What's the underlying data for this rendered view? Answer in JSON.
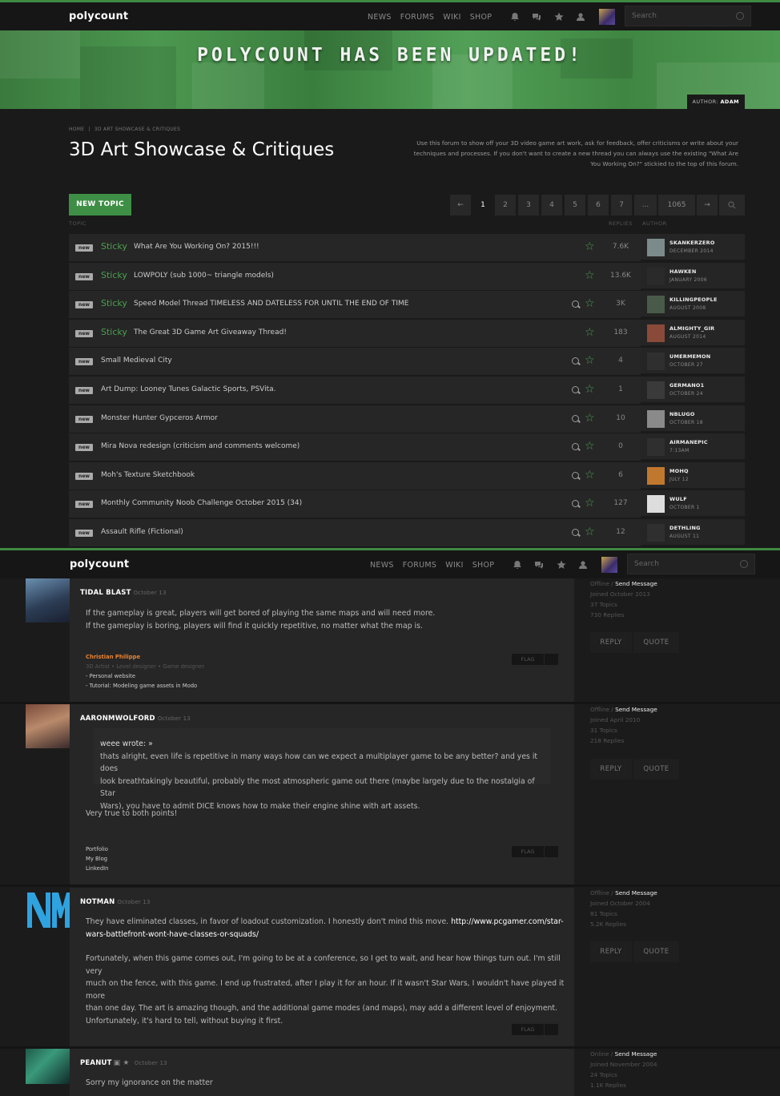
{
  "nav": {
    "logo": "polycount",
    "links": [
      "NEWS",
      "FORUMS",
      "WIKI",
      "SHOP"
    ],
    "search_placeholder": "Search"
  },
  "banner": {
    "title": "POLYCOUNT HAS BEEN UPDATED!",
    "author_label": "AUTHOR:",
    "author_name": "ADAM"
  },
  "breadcrumb": [
    "HOME",
    "3D ART SHOWCASE & CRITIQUES"
  ],
  "page_title": "3D Art Showcase & Critiques",
  "description": "Use this forum to show off your 3D video game art work, ask for feedback, offer criticisms or write about your techniques and processes. If you don't want to create a new thread you can always use the existing \"What Are You Working On?\" stickied to the top of this forum.",
  "new_topic": "NEW TOPIC",
  "pagination": {
    "prev": "←",
    "pages": [
      "1",
      "2",
      "3",
      "4",
      "5",
      "6",
      "7",
      "...",
      "1065"
    ],
    "next": "→"
  },
  "columns": {
    "topic": "TOPIC",
    "replies": "REPLIES",
    "author": "AUTHOR"
  },
  "threads": [
    {
      "badge": "new",
      "sticky": "Sticky",
      "title": "What Are You Working On? 2015!!!",
      "search": false,
      "replies": "7.6K",
      "author": "SKANKERZERO",
      "date": "DECEMBER 2014",
      "avatar_color": "#7b8a8a"
    },
    {
      "badge": "new",
      "sticky": "Sticky",
      "title": "LOWPOLY (sub 1000~ triangle models)",
      "search": false,
      "replies": "13.6K",
      "author": "HAWKEN",
      "date": "JANUARY 2006",
      "avatar_color": "#2a2a2a"
    },
    {
      "badge": "new",
      "sticky": "Sticky",
      "title": "Speed Model Thread TIMELESS AND DATELESS FOR UNTIL THE END OF TIME",
      "search": true,
      "replies": "3K",
      "author": "KILLINGPEOPLE",
      "date": "AUGUST 2008",
      "avatar_color": "#4a5a4a"
    },
    {
      "badge": "new",
      "sticky": "Sticky",
      "title": "The Great 3D Game Art Giveaway Thread!",
      "search": false,
      "replies": "183",
      "author": "ALMIGHTY_GIR",
      "date": "AUGUST 2014",
      "avatar_color": "#8a4a3a"
    },
    {
      "badge": "new",
      "sticky": "",
      "title": "Small Medieval City",
      "search": true,
      "replies": "4",
      "author": "UMERMEMON",
      "date": "OCTOBER 27",
      "avatar_color": "#2f2f2f"
    },
    {
      "badge": "new",
      "sticky": "",
      "title": "Art Dump: Looney Tunes Galactic Sports, PSVita.",
      "search": true,
      "replies": "1",
      "author": "GERMANO1",
      "date": "OCTOBER 24",
      "avatar_color": "#3a3a3a"
    },
    {
      "badge": "new",
      "sticky": "",
      "title": "Monster Hunter Gypceros Armor",
      "search": true,
      "replies": "10",
      "author": "NBLUGO",
      "date": "OCTOBER 18",
      "avatar_color": "#8a8a8a"
    },
    {
      "badge": "new",
      "sticky": "",
      "title": "Mira Nova redesign (criticism and comments welcome)",
      "search": true,
      "replies": "0",
      "author": "AIRMANEPIC",
      "date": "7:13AM",
      "avatar_color": "#2f2f2f"
    },
    {
      "badge": "new",
      "sticky": "",
      "title": "Moh's Texture Sketchbook",
      "search": true,
      "replies": "6",
      "author": "MOHQ",
      "date": "JULY 12",
      "avatar_color": "#c0782f"
    },
    {
      "badge": "new",
      "sticky": "",
      "title": "Monthly Community Noob Challenge October 2015 (34)",
      "search": true,
      "replies": "127",
      "author": "WULF",
      "date": "OCTOBER 1",
      "avatar_color": "#ddd"
    },
    {
      "badge": "new",
      "sticky": "",
      "title": "Assault Rifle (Fictional)",
      "search": true,
      "replies": "12",
      "author": "DETHLING",
      "date": "AUGUST 11",
      "avatar_color": "#2f2f2f"
    }
  ],
  "posts": [
    {
      "author": "TIDAL BLAST",
      "date": "October 13",
      "lines": [
        "If the gameplay is great, players will get bored of playing the same maps and will need more.",
        "If the gameplay is boring, players will find it quickly repetitive, no matter what the map is."
      ],
      "sig": {
        "name": "Christian Philippe",
        "role": "3D Artist • Level designer • Game designer",
        "links": [
          "- Personal website",
          "- Tutorial: Modeling game assets in Modo"
        ]
      },
      "flag": "FLAG",
      "status": "Offline",
      "send": "Send Message",
      "joined": "Joined October 2013",
      "topics": "37 Topics",
      "replies": "730 Replies",
      "reply_btn": "REPLY",
      "quote_btn": "QUOTE"
    },
    {
      "author": "AARONMWOLFORD",
      "date": "October 13",
      "quote_author": "weee",
      "quote_wrote": "wrote: »",
      "quote_lines": [
        "thats alright, even life is repetitive in many ways how can we expect a multiplayer game to be any better? and yes it does",
        "look breathtakingly beautiful, probably the most atmospheric game out there (maybe largely due to the nostalgia of Star",
        "Wars), you have to admit DICE knows how to make their engine shine with art assets."
      ],
      "text": "Very true to both points!",
      "sig_links": [
        "Portfolio",
        "My Blog",
        "LinkedIn"
      ],
      "flag": "FLAG",
      "status": "Offline",
      "send": "Send Message",
      "joined": "Joined April 2010",
      "topics": "31 Topics",
      "replies": "218 Replies",
      "reply_btn": "REPLY",
      "quote_btn": "QUOTE"
    },
    {
      "author": "NOTMAN",
      "date": "October 13",
      "p1a": "They have eliminated classes, in favor of loadout customization. I honestly don't mind this move. ",
      "p1link": "http://www.pcgamer.com/star-",
      "p1b": "wars-battlefront-wont-have-classes-or-squads/",
      "p2": [
        "Fortunately, when this game comes out, I'm going to be at a conference, so I get to wait, and hear how things turn out. I'm still very",
        "much on the fence, with this game. I end up frustrated, after I play it for an hour. If it wasn't Star Wars, I wouldn't have played it more",
        "than one day. The art is amazing though, and the additional game modes (and maps), may add a different level of enjoyment.",
        "Unfortunately, it's hard to tell, without buying it first."
      ],
      "flag": "FLAG",
      "status": "Offline",
      "send": "Send Message",
      "joined": "Joined October 2004",
      "topics": "81 Topics",
      "replies": "5.2K Replies",
      "reply_btn": "REPLY",
      "quote_btn": "QUOTE"
    },
    {
      "author": "PEANUT",
      "date": "October 13",
      "text": "Sorry my ignorance on the matter",
      "status": "Online",
      "send": "Send Message",
      "joined": "Joined November 2004",
      "topics": "24 Topics",
      "replies": "1.1K Replies"
    }
  ]
}
